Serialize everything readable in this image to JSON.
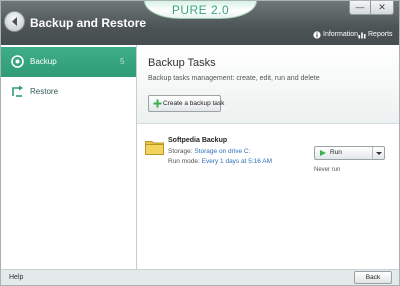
{
  "window": {
    "title": "Backup and Restore",
    "brand": "PURE 2.0",
    "minimize_glyph": "—",
    "close_glyph": "✕"
  },
  "toolbar": {
    "information_label": "Information",
    "reports_label": "Reports"
  },
  "sidebar": {
    "items": [
      {
        "label": "Backup",
        "icon": "backup-icon",
        "badge": "5",
        "active": true
      },
      {
        "label": "Restore",
        "icon": "restore-icon",
        "active": false
      }
    ]
  },
  "main": {
    "title": "Backup Tasks",
    "subtitle": "Backup tasks management: create, edit, run and delete",
    "create_button": "Create a backup task",
    "task": {
      "name": "Softpedia Backup",
      "storage_label": "Storage:",
      "storage_value": "Storage on drive C:",
      "run_mode_label": "Run mode:",
      "run_mode_value": "Every 1 days at 5:16 AM",
      "run_button": "Run",
      "status": "Never run"
    }
  },
  "statusbar": {
    "help_label": "Help",
    "back_button": "Back"
  },
  "colors": {
    "accent": "#2f9b78",
    "titlebar": "#4c5456",
    "link": "#2d72b8"
  }
}
